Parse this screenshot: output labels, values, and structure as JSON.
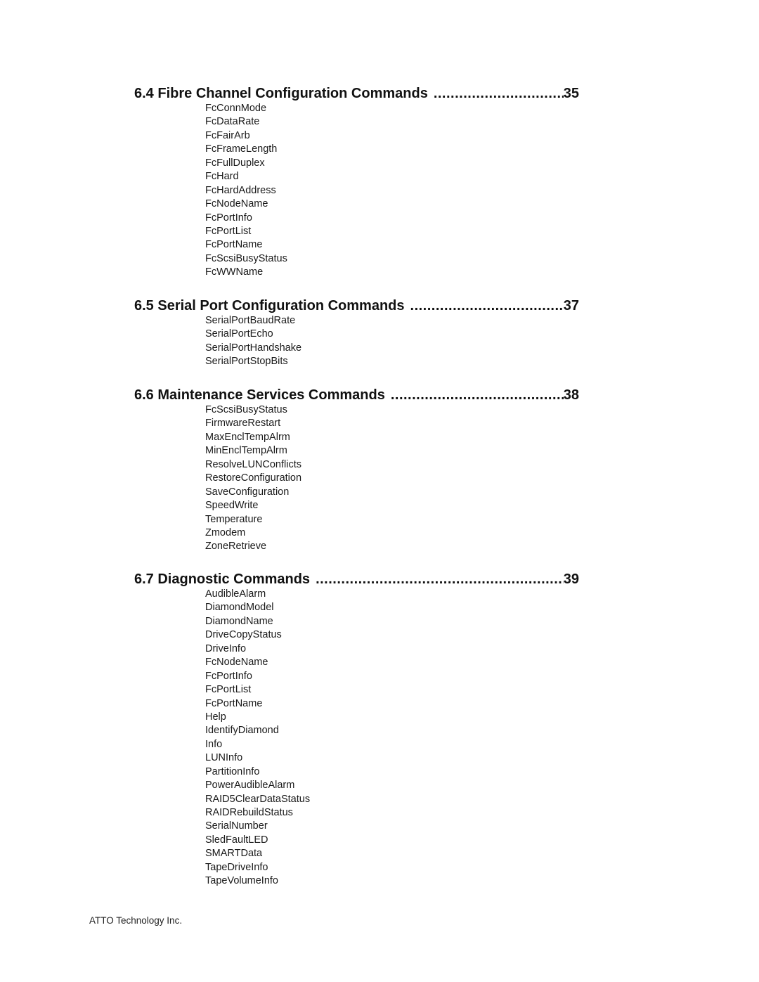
{
  "sections": [
    {
      "title": "6.4 Fibre Channel Configuration Commands",
      "page": "35",
      "items": [
        "FcConnMode",
        "FcDataRate",
        "FcFairArb",
        "FcFrameLength",
        "FcFullDuplex",
        "FcHard",
        "FcHardAddress",
        "FcNodeName",
        "FcPortInfo",
        "FcPortList",
        "FcPortName",
        "FcScsiBusyStatus",
        "FcWWName"
      ]
    },
    {
      "title": "6.5 Serial Port Configuration Commands",
      "page": "37",
      "items": [
        "SerialPortBaudRate",
        "SerialPortEcho",
        "SerialPortHandshake",
        "SerialPortStopBits"
      ]
    },
    {
      "title": "6.6 Maintenance Services Commands",
      "page": "38",
      "items": [
        "FcScsiBusyStatus",
        "FirmwareRestart",
        "MaxEnclTempAlrm",
        "MinEnclTempAlrm",
        "ResolveLUNConflicts",
        "RestoreConfiguration",
        "SaveConfiguration",
        "SpeedWrite",
        "Temperature",
        "Zmodem",
        "ZoneRetrieve"
      ]
    },
    {
      "title": "6.7 Diagnostic Commands",
      "page": "39",
      "items": [
        "AudibleAlarm",
        "DiamondModel",
        "DiamondName",
        "DriveCopyStatus",
        "DriveInfo",
        "FcNodeName",
        "FcPortInfo",
        "FcPortList",
        "FcPortName",
        "Help",
        "IdentifyDiamond",
        "Info",
        "LUNInfo",
        "PartitionInfo",
        "PowerAudibleAlarm",
        "RAID5ClearDataStatus",
        "RAIDRebuildStatus",
        "SerialNumber",
        "SledFaultLED",
        "SMARTData",
        "TapeDriveInfo",
        "TapeVolumeInfo"
      ]
    }
  ],
  "footer": {
    "text": "ATTO Technology Inc."
  }
}
